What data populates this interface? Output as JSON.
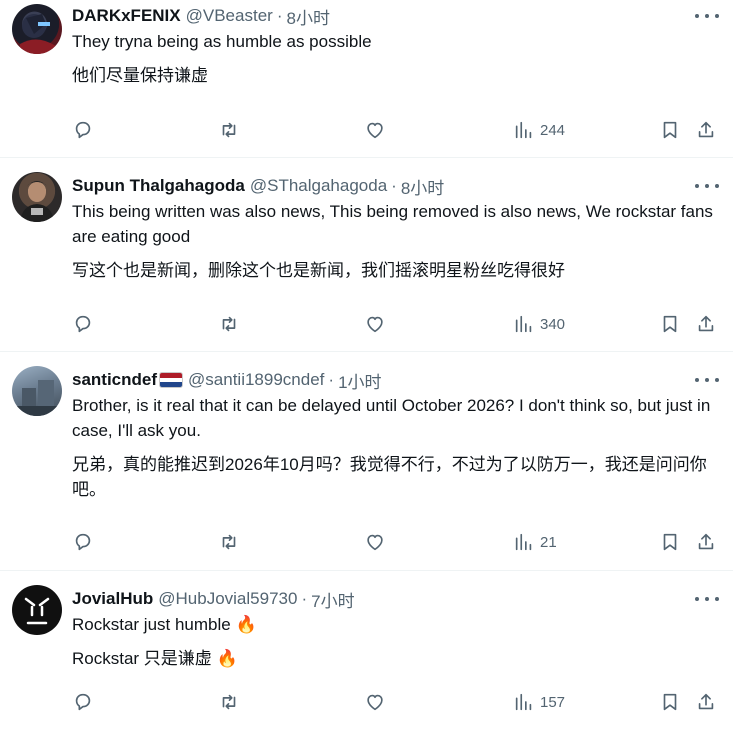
{
  "tweets": [
    {
      "display_name": "DARKxFENIX",
      "handle": "@VBeaster",
      "time": "8小时",
      "text_en": "They tryna being as humble as possible",
      "text_zh": "他们尽量保持谦虚",
      "views": "244"
    },
    {
      "display_name": "Supun Thalgahagoda",
      "handle": "@SThalgahagoda",
      "time": "8小时",
      "text_en": "This being written was also news, This being removed is also news, We rockstar fans are eating good",
      "text_zh": "写这个也是新闻，删除这个也是新闻，我们摇滚明星粉丝吃得很好",
      "views": "340"
    },
    {
      "display_name": "santicndef",
      "handle": "@santii1899cndef",
      "time": "1小时",
      "text_en": "Brother, is it real that it can be delayed until October 2026? I don't think so, but just in case, I'll ask you.",
      "text_zh": "兄弟，真的能推迟到2026年10月吗？我觉得不行，不过为了以防万一，我还是问问你吧。",
      "views": "21"
    },
    {
      "display_name": "JovialHub",
      "handle": "@HubJovial59730",
      "time": "7小时",
      "text_en": "Rockstar just humble 🔥",
      "text_zh": "Rockstar 只是谦虚 🔥",
      "views": "157"
    }
  ],
  "separator": "·",
  "colors": {
    "primary_text": "#0f1419",
    "secondary_text": "#536471",
    "divider": "#eff3f4",
    "flag_red": "#ae1c28",
    "flag_white": "#ffffff",
    "flag_blue": "#21468b"
  },
  "icons": [
    "reply-icon",
    "retweet-icon",
    "like-icon",
    "views-icon",
    "bookmark-icon",
    "share-icon",
    "more-icon"
  ]
}
